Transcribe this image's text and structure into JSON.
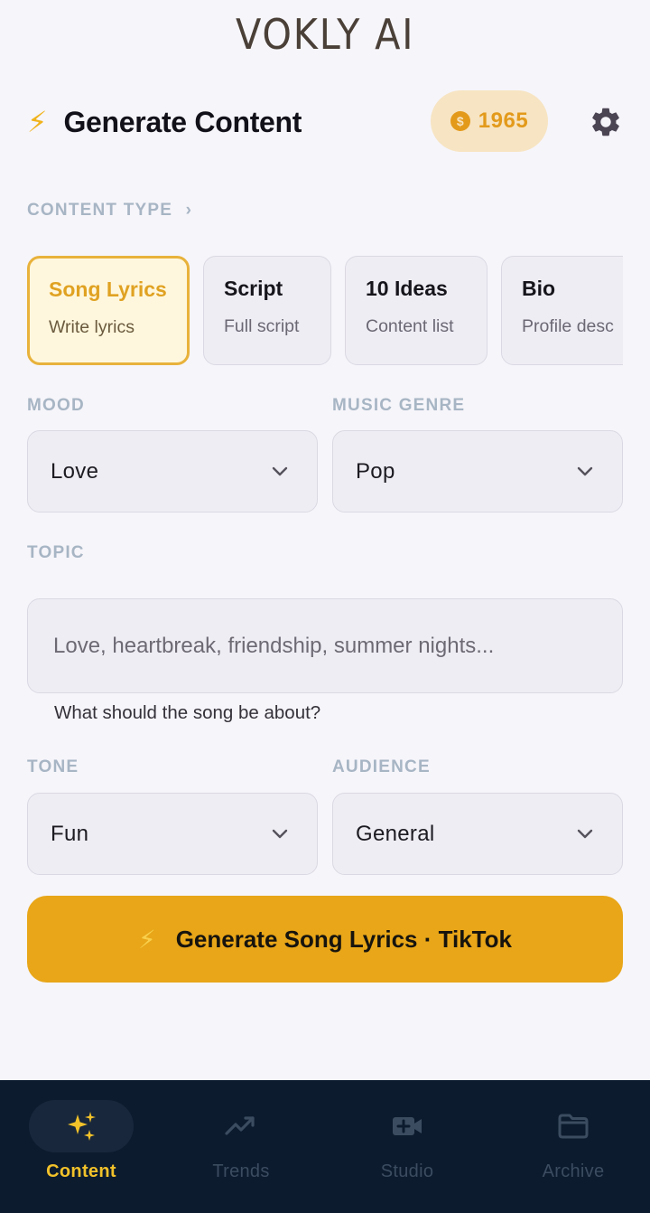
{
  "brand": {
    "name": "VOKLY AI"
  },
  "header": {
    "title": "Generate Content",
    "coins": "1965",
    "coin_symbol": "$"
  },
  "content_type": {
    "label": "CONTENT TYPE",
    "items": [
      {
        "name": "Song Lyrics",
        "desc": "Write lyrics",
        "selected": true
      },
      {
        "name": "Script",
        "desc": "Full script",
        "selected": false
      },
      {
        "name": "10 Ideas",
        "desc": "Content list",
        "selected": false
      },
      {
        "name": "Bio",
        "desc": "Profile desc",
        "selected": false
      }
    ]
  },
  "mood": {
    "label": "MOOD",
    "value": "Love"
  },
  "music_genre": {
    "label": "MUSIC GENRE",
    "value": "Pop"
  },
  "topic": {
    "label": "TOPIC",
    "value": "",
    "placeholder": "Love, heartbreak, friendship, summer nights...",
    "hint": "What should the song be about?"
  },
  "tone": {
    "label": "TONE",
    "value": "Fun"
  },
  "audience": {
    "label": "AUDIENCE",
    "value": "General"
  },
  "generate_button": {
    "label": "Generate Song Lyrics · TikTok"
  },
  "nav": {
    "items": [
      {
        "label": "Content",
        "icon": "sparkles-icon",
        "active": true
      },
      {
        "label": "Trends",
        "icon": "trending-up-icon",
        "active": false
      },
      {
        "label": "Studio",
        "icon": "video-plus-icon",
        "active": false
      },
      {
        "label": "Archive",
        "icon": "folder-icon",
        "active": false
      }
    ]
  },
  "colors": {
    "accent": "#e8a618",
    "accent_text": "#e0a222",
    "nav_bg": "#0c1b2e",
    "nav_active": "#f2c22a",
    "nav_inactive": "#3c4c60",
    "page_bg": "#f6f5fa"
  }
}
